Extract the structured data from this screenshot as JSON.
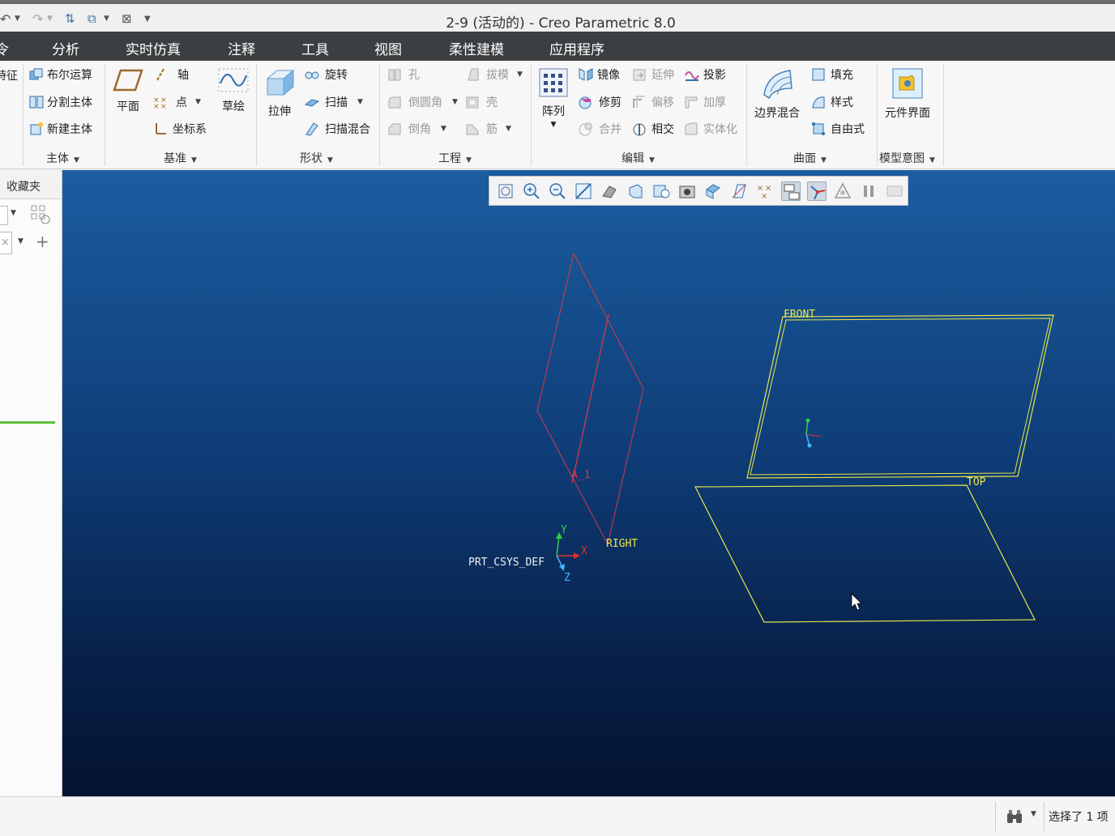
{
  "window": {
    "title": "2-9 (活动的) - Creo Parametric 8.0"
  },
  "menu": {
    "items": [
      {
        "label": "令"
      },
      {
        "label": "分析"
      },
      {
        "label": "实时仿真"
      },
      {
        "label": "注释"
      },
      {
        "label": "工具"
      },
      {
        "label": "视图"
      },
      {
        "label": "柔性建模"
      },
      {
        "label": "应用程序"
      }
    ]
  },
  "ribbon": {
    "partial_left": "特征",
    "body": {
      "boolean": "布尔运算",
      "split": "分割主体",
      "new_body": "新建主体",
      "group": "主体"
    },
    "datum": {
      "plane": "平面",
      "axis": "轴",
      "point": "点",
      "csys": "坐标系",
      "sketch": "草绘",
      "group": "基准"
    },
    "shape": {
      "extrude": "拉伸",
      "revolve": "旋转",
      "sweep": "扫描",
      "swept_blend": "扫描混合",
      "group": "形状"
    },
    "engineering": {
      "hole": "孔",
      "round": "倒圆角",
      "chamfer": "倒角",
      "draft": "拔模",
      "shell": "壳",
      "rib": "筋",
      "group": "工程"
    },
    "editing": {
      "pattern": "阵列",
      "mirror": "镜像",
      "trim": "修剪",
      "merge": "合并",
      "extend": "延伸",
      "offset": "偏移",
      "intersect": "相交",
      "project": "投影",
      "thicken": "加厚",
      "solidify": "实体化",
      "group": "编辑"
    },
    "surfaces": {
      "boundary_blend": "边界混合",
      "fill": "填充",
      "style": "样式",
      "freestyle": "自由式",
      "group": "曲面"
    },
    "model_intent": {
      "component_interface": "元件界面",
      "group": "模型意图"
    }
  },
  "left_panel": {
    "tab": "收藏夹"
  },
  "scene": {
    "labels": {
      "front": "FRONT",
      "top": "TOP",
      "right": "RIGHT",
      "axis": "A_1",
      "csys": "PRT_CSYS_DEF",
      "x": "X",
      "y": "Y",
      "z": "Z"
    },
    "colors": {
      "datum_plane": "#e8e84a",
      "selected_plane": "#d23a4a",
      "x_axis": "#e03030",
      "y_axis": "#30d040",
      "z_axis": "#40b8ff"
    }
  },
  "status": {
    "message": "选择了 1 项"
  }
}
